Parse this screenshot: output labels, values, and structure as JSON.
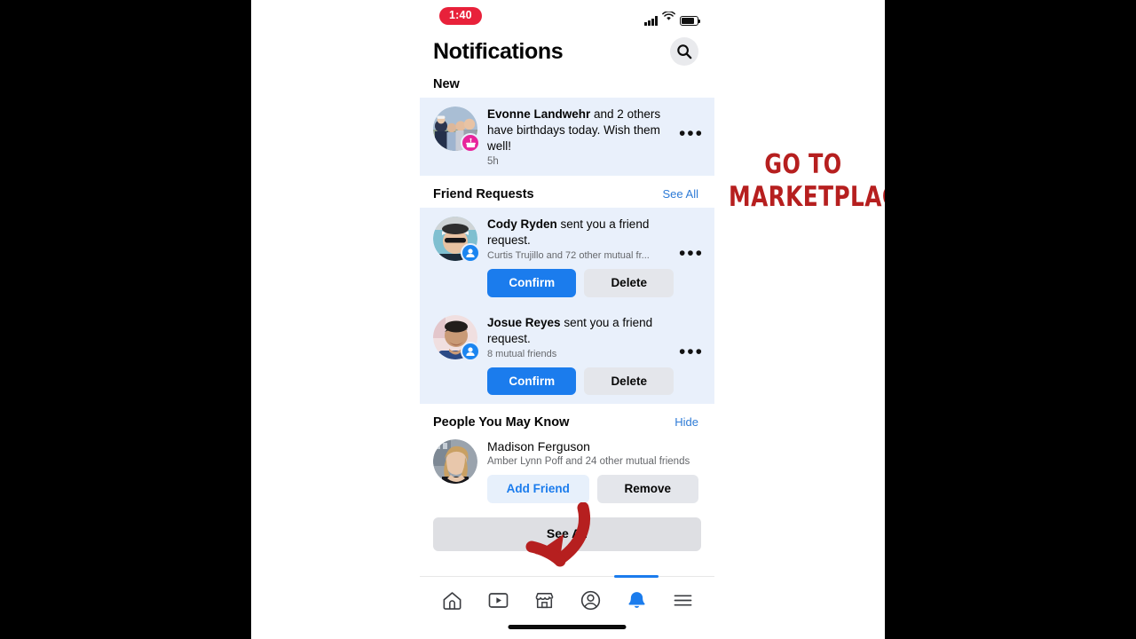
{
  "status_bar": {
    "recording_time": "1:40",
    "signal_icon": "cellular-signal-icon",
    "wifi_icon": "wifi-icon",
    "battery_icon": "battery-icon"
  },
  "header": {
    "title": "Notifications",
    "search_icon": "search-icon"
  },
  "sections": {
    "new": {
      "title": "New"
    },
    "friend_requests": {
      "title": "Friend Requests",
      "see_all": "See All"
    },
    "people_you_may_know": {
      "title": "People You May Know",
      "hide": "Hide"
    }
  },
  "birthday_notification": {
    "name": "Evonne Landwehr",
    "rest": " and 2 others have birthdays today. Wish them well!",
    "time": "5h",
    "badge_icon": "birthday-cake-icon",
    "badge_color": "#e8249b",
    "menu_icon": "more-options-icon"
  },
  "friend_requests": [
    {
      "name": "Cody Ryden",
      "rest": " sent you a friend request.",
      "mutual": "Curtis Trujillo and 72 other mutual fr...",
      "confirm": "Confirm",
      "delete": "Delete",
      "badge_icon": "friend-request-icon",
      "menu_icon": "more-options-icon"
    },
    {
      "name": "Josue Reyes",
      "rest": " sent you a friend request.",
      "mutual": "8 mutual friends",
      "confirm": "Confirm",
      "delete": "Delete",
      "badge_icon": "friend-request-icon",
      "menu_icon": "more-options-icon"
    }
  ],
  "suggestions": [
    {
      "name": "Madison Ferguson",
      "mutual": "Amber Lynn Poff and 24 other mutual friends",
      "add": "Add Friend",
      "remove": "Remove"
    }
  ],
  "see_all_button": "See All",
  "tab_bar": {
    "items": [
      {
        "icon": "home-icon",
        "active": false
      },
      {
        "icon": "video-icon",
        "active": false
      },
      {
        "icon": "marketplace-icon",
        "active": false
      },
      {
        "icon": "profile-icon",
        "active": false
      },
      {
        "icon": "notifications-bell-icon",
        "active": true
      },
      {
        "icon": "menu-hamburger-icon",
        "active": false
      }
    ],
    "active_color": "#1b7ced"
  },
  "annotation": {
    "line1": "GO TO",
    "line2": "MARKETPLACE",
    "color": "#b61f1f",
    "arrow_icon": "curved-down-arrow-annotation"
  }
}
